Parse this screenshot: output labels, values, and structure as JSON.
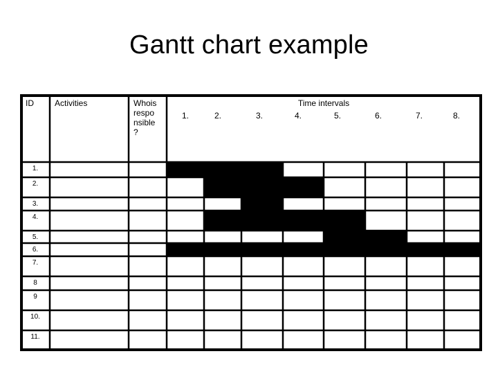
{
  "chart_data": {
    "type": "gantt",
    "title": "Gantt chart example",
    "columns": {
      "id": "ID",
      "activities": "Activities",
      "responsible": [
        "Whois",
        "respo",
        "nsible",
        "?"
      ],
      "time_header": "Time intervals"
    },
    "intervals": [
      "1.",
      "2.",
      "3.",
      "4.",
      "5.",
      "6.",
      "7.",
      "8."
    ],
    "rows": [
      {
        "id": "1.",
        "activity": "",
        "responsible": "",
        "start": 1,
        "end": 3
      },
      {
        "id": "2.",
        "activity": "",
        "responsible": "",
        "start": 2,
        "end": 4
      },
      {
        "id": "3.",
        "activity": "",
        "responsible": "",
        "start": 3,
        "end": 3
      },
      {
        "id": "4.",
        "activity": "",
        "responsible": "",
        "start": 2,
        "end": 5
      },
      {
        "id": "5.",
        "activity": "",
        "responsible": "",
        "start": 5,
        "end": 6
      },
      {
        "id": "6.",
        "activity": "",
        "responsible": "",
        "start": 1,
        "end": 8
      },
      {
        "id": "7.",
        "activity": "",
        "responsible": "",
        "start": null,
        "end": null
      },
      {
        "id": "8",
        "activity": "",
        "responsible": "",
        "start": null,
        "end": null
      },
      {
        "id": "9",
        "activity": "",
        "responsible": "",
        "start": null,
        "end": null
      },
      {
        "id": "10.",
        "activity": "",
        "responsible": "",
        "start": null,
        "end": null
      },
      {
        "id": "11.",
        "activity": "",
        "responsible": "",
        "start": null,
        "end": null
      }
    ],
    "bar_color": "#000000",
    "grid_color": "#000000"
  }
}
